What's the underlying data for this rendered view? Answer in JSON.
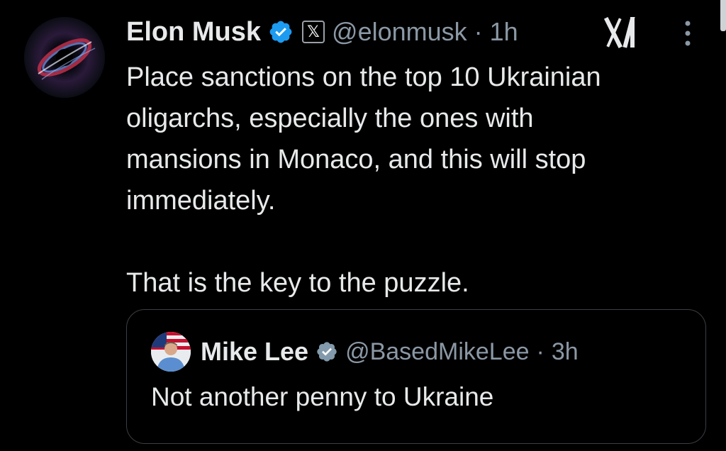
{
  "tweet": {
    "author_name": "Elon Musk",
    "handle": "@elonmusk",
    "separator": "·",
    "time": "1h",
    "affiliate_mark": "𝕏",
    "text": "Place sanctions on the top 10 Ukrainian\noligarchs, especially the ones with\nmansions in Monaco, and this will stop\nimmediately.\n\nThat is the key to the puzzle."
  },
  "quoted": {
    "author_name": "Mike Lee",
    "handle": "@BasedMikeLee",
    "separator": "·",
    "time": "3h",
    "text": "Not another penny to Ukraine"
  },
  "icons": {
    "verified": "verified-badge-icon",
    "verified_quote": "gray-verified-badge-icon",
    "grok": "grok-icon",
    "more": "more-vertical-icon"
  },
  "colors": {
    "background": "#000000",
    "primary_text": "#e7e9ea",
    "secondary_text": "#8b98a5",
    "verified_blue": "#1d9bf0",
    "verified_gray": "#829aab",
    "border": "#3a3f44"
  }
}
